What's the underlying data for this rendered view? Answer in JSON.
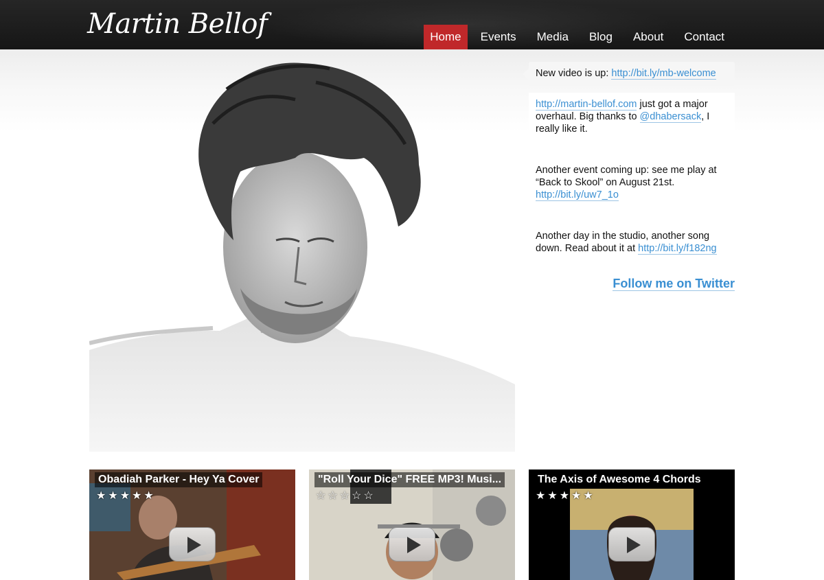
{
  "brand": {
    "logo_text": "Martin Bellof"
  },
  "nav": {
    "items": [
      {
        "label": "Home",
        "active": true
      },
      {
        "label": "Events"
      },
      {
        "label": "Media"
      },
      {
        "label": "Blog"
      },
      {
        "label": "About"
      },
      {
        "label": "Contact"
      }
    ]
  },
  "colors": {
    "header_bg": "#1c1c1c",
    "active_nav": "#c0282a",
    "link": "#3a8fd2"
  },
  "tweets": [
    {
      "parts": [
        {
          "text": "New video is up: "
        },
        {
          "link": "http://bit.ly/mb-welcome"
        }
      ]
    },
    {
      "parts": [
        {
          "link": "http://martin-bellof.com"
        },
        {
          "text": " just got a major overhaul. Big thanks to "
        },
        {
          "link": "@dhabersack"
        },
        {
          "text": ", I really like it."
        }
      ]
    },
    {
      "parts": [
        {
          "text": "Another event coming up: see me play at “Back to Skool” on August 21st. "
        },
        {
          "link": "http://bit.ly/uw7_1o"
        }
      ]
    },
    {
      "parts": [
        {
          "text": "Another day in the studio, another song down. Read about it at "
        },
        {
          "link": "http://bit.ly/f182ng"
        }
      ]
    }
  ],
  "follow_label": "Follow me on Twitter",
  "videos": [
    {
      "title": "Obadiah Parker - Hey Ya Cover",
      "rating": 5,
      "stars": "★★★★★"
    },
    {
      "title": "\"Roll Your Dice\" FREE MP3! Musi...",
      "rating": 5,
      "stars": "☆☆☆☆☆"
    },
    {
      "title": "The Axis of Awesome 4 Chords",
      "rating": 5,
      "stars": "★★★★★"
    }
  ]
}
